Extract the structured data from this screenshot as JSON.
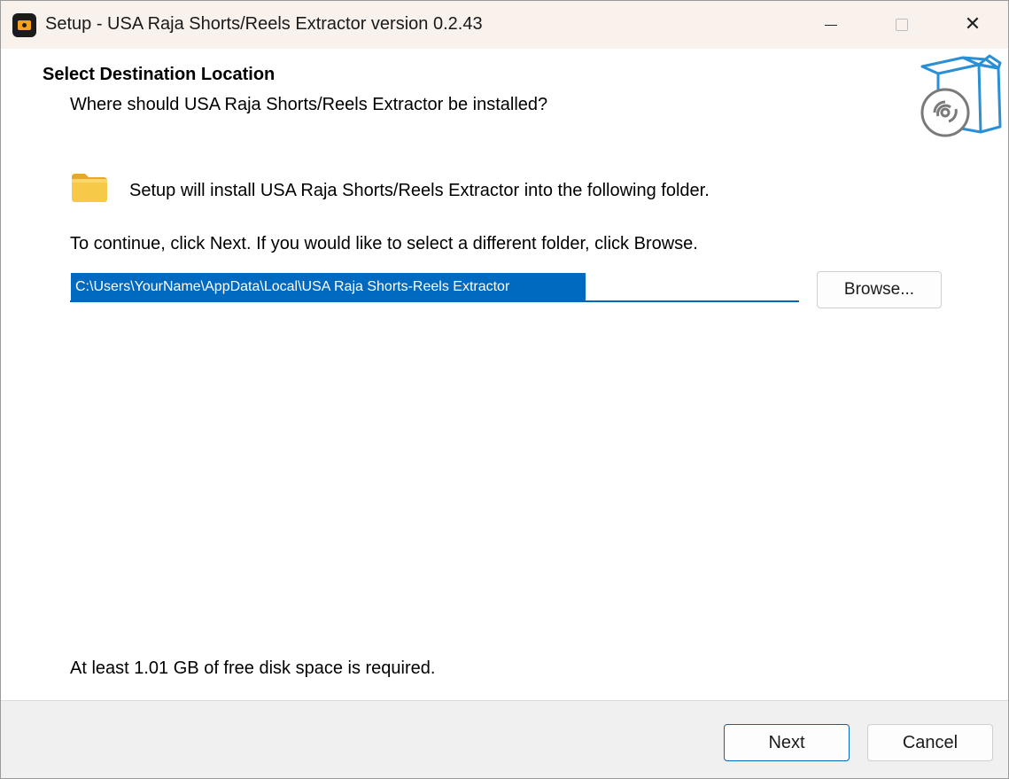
{
  "window": {
    "title": "Setup - USA Raja Shorts/Reels Extractor version 0.2.43",
    "app_icon": "camera-app-icon",
    "controls": {
      "minimize_icon": "minimize-icon",
      "maximize_icon": "maximize-icon",
      "close_glyph": "✕"
    }
  },
  "header": {
    "title": "Select Destination Location",
    "subtitle": "Where should USA Raja Shorts/Reels Extractor be installed?",
    "icon": "install-box-disc-icon"
  },
  "body": {
    "folder_icon": "folder-icon",
    "install_text": "Setup will install USA Raja Shorts/Reels Extractor into the following folder.",
    "continue_text": "To continue, click Next. If you would like to select a different folder, click Browse.",
    "path_value": "C:\\Users\\YourName\\AppData\\Local\\USA Raja Shorts-Reels Extractor",
    "browse_label": "Browse...",
    "disk_space_text": "At least 1.01 GB of free disk space is required."
  },
  "footer": {
    "next_label": "Next",
    "cancel_label": "Cancel"
  },
  "colors": {
    "accent": "#0067c0",
    "selection": "#0069c0",
    "titlebar": "#f9f1ec",
    "footer": "#f0f0f0",
    "folder": "#f5c64a",
    "box_icon": "#2a8fd4"
  }
}
